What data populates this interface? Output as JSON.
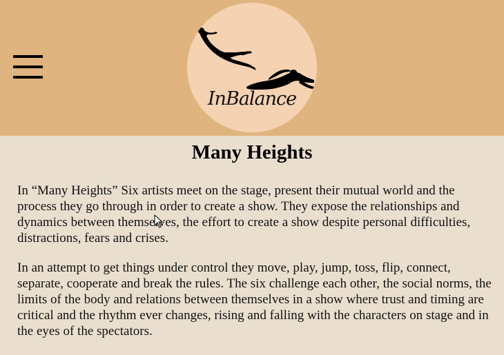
{
  "header": {
    "logo_text": "InBalance",
    "menu_icon": "hamburger-menu-icon",
    "colors": {
      "header_bg": "#e0b47f",
      "logo_circle": "#f5d3b2",
      "page_bg": "#eadfcf"
    }
  },
  "main": {
    "title": "Many Heights",
    "paragraphs": [
      "In “Many Heights” Six artists meet on the stage, present their mutual world and the process they go through in order to create a show. They expose the relationships and dynamics between themselves, the effort to create a show despite personal difficulties, distractions, fears and crises.",
      "In an attempt to get things under control they move, play, jump, toss, flip, connect, separate, cooperate and break the rules. The six challenge each other, the social norms, the limits of the body and relations between themselves in a show where trust and timing are critical and the rhythm ever changes, rising and falling with the characters on stage and in the eyes of the spectators."
    ]
  }
}
